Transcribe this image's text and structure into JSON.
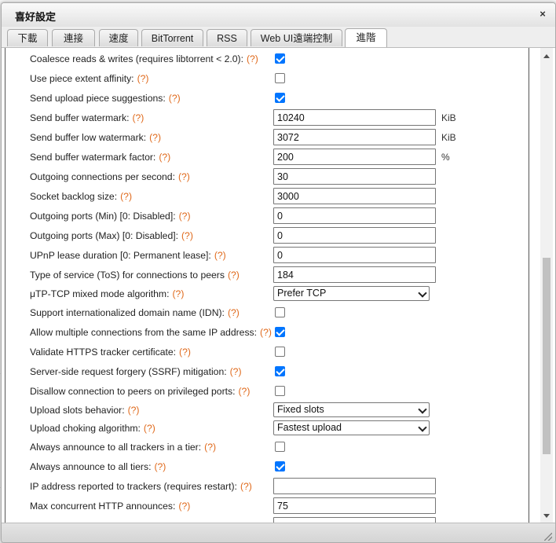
{
  "dialog": {
    "title": "喜好設定",
    "close_glyph": "×"
  },
  "tabs": [
    {
      "label": "下載",
      "active": false
    },
    {
      "label": "連接",
      "active": false
    },
    {
      "label": "速度",
      "active": false
    },
    {
      "label": "BitTorrent",
      "active": false
    },
    {
      "label": "RSS",
      "active": false
    },
    {
      "label": "Web UI遠端控制",
      "active": false
    },
    {
      "label": "進階",
      "active": true
    }
  ],
  "help_marker": "(?)",
  "settings": [
    {
      "label": "Coalesce reads & writes (requires libtorrent < 2.0):",
      "type": "checkbox",
      "checked": true
    },
    {
      "label": "Use piece extent affinity:",
      "type": "checkbox",
      "checked": false
    },
    {
      "label": "Send upload piece suggestions:",
      "type": "checkbox",
      "checked": true
    },
    {
      "label": "Send buffer watermark:",
      "type": "input",
      "value": "10240",
      "unit": "KiB"
    },
    {
      "label": "Send buffer low watermark:",
      "type": "input",
      "value": "3072",
      "unit": "KiB"
    },
    {
      "label": "Send buffer watermark factor:",
      "type": "input",
      "value": "200",
      "unit": "%"
    },
    {
      "label": "Outgoing connections per second:",
      "type": "input",
      "value": "30"
    },
    {
      "label": "Socket backlog size:",
      "type": "input",
      "value": "3000"
    },
    {
      "label": "Outgoing ports (Min) [0: Disabled]:",
      "type": "input",
      "value": "0"
    },
    {
      "label": "Outgoing ports (Max) [0: Disabled]:",
      "type": "input",
      "value": "0"
    },
    {
      "label": "UPnP lease duration [0: Permanent lease]:",
      "type": "input",
      "value": "0"
    },
    {
      "label": "Type of service (ToS) for connections to peers",
      "type": "input",
      "value": "184"
    },
    {
      "label": "μTP-TCP mixed mode algorithm:",
      "type": "select",
      "value": "Prefer TCP"
    },
    {
      "label": "Support internationalized domain name (IDN):",
      "type": "checkbox",
      "checked": false
    },
    {
      "label": "Allow multiple connections from the same IP address:",
      "type": "checkbox",
      "checked": true
    },
    {
      "label": "Validate HTTPS tracker certificate:",
      "type": "checkbox",
      "checked": false
    },
    {
      "label": "Server-side request forgery (SSRF) mitigation:",
      "type": "checkbox",
      "checked": true
    },
    {
      "label": "Disallow connection to peers on privileged ports:",
      "type": "checkbox",
      "checked": false
    },
    {
      "label": "Upload slots behavior:",
      "type": "select",
      "value": "Fixed slots"
    },
    {
      "label": "Upload choking algorithm:",
      "type": "select",
      "value": "Fastest upload"
    },
    {
      "label": "Always announce to all trackers in a tier:",
      "type": "checkbox",
      "checked": false
    },
    {
      "label": "Always announce to all tiers:",
      "type": "checkbox",
      "checked": true
    },
    {
      "label": "IP address reported to trackers (requires restart):",
      "type": "input",
      "value": ""
    },
    {
      "label": "Max concurrent HTTP announces:",
      "type": "input",
      "value": "75"
    },
    {
      "label": "",
      "type": "input",
      "value": ""
    }
  ]
}
